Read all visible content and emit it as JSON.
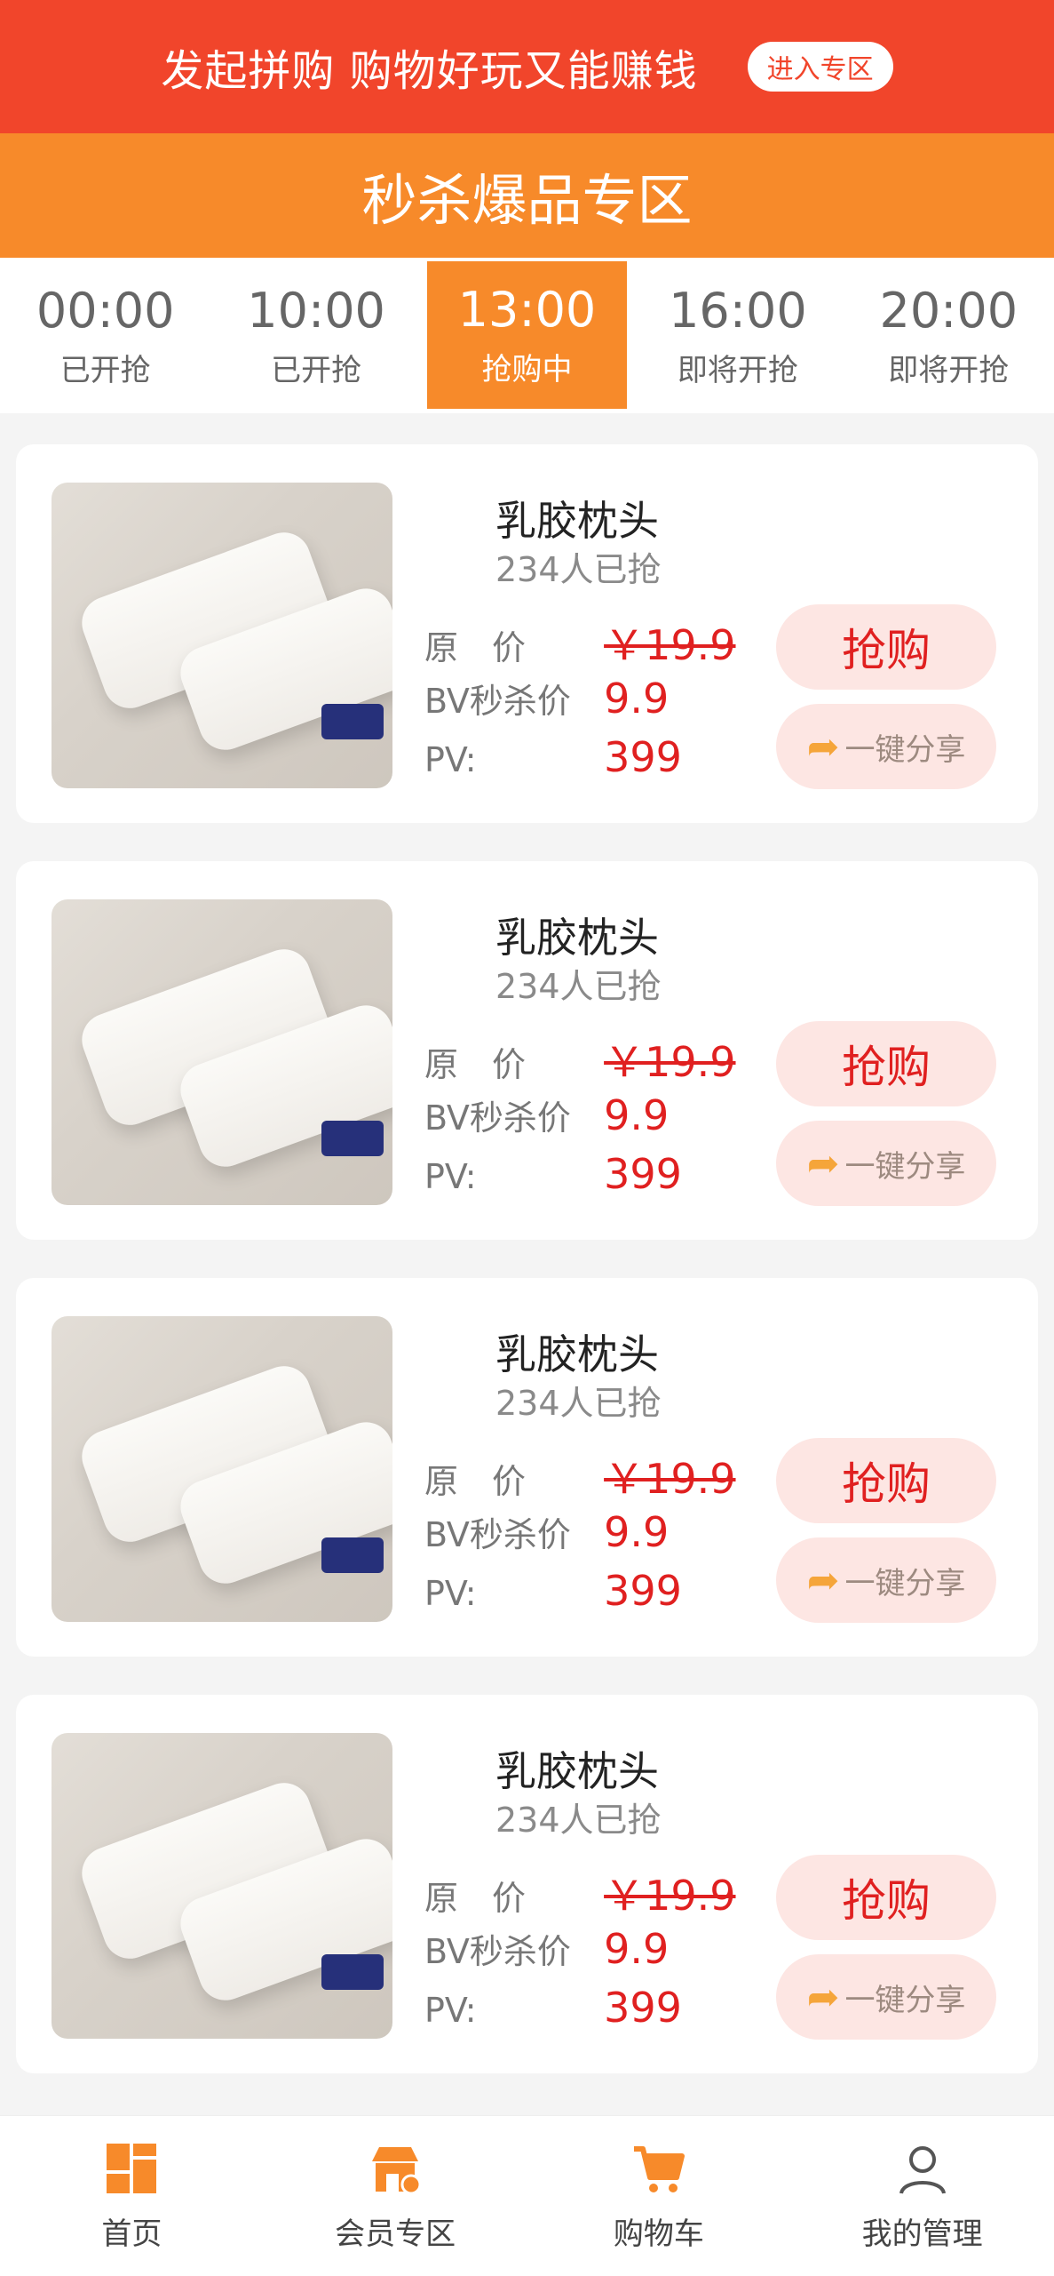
{
  "banner": {
    "text": "发起拼购 购物好玩又能赚钱",
    "button": "进入专区"
  },
  "section": {
    "title": "秒杀爆品专区"
  },
  "tabs": [
    {
      "time": "00:00",
      "status": "已开抢"
    },
    {
      "time": "10:00",
      "status": "已开抢"
    },
    {
      "time": "13:00",
      "status": "抢购中"
    },
    {
      "time": "16:00",
      "status": "即将开抢"
    },
    {
      "time": "20:00",
      "status": "即将开抢"
    }
  ],
  "products": [
    {
      "title": "乳胶枕头",
      "sold": "234人已抢",
      "orig_label": "原　价",
      "orig_price": "￥19.9",
      "bv_label": "BV秒杀价",
      "bv_price": "9.9",
      "pv_label": "PV:",
      "pv_value": "399",
      "buy": "抢购",
      "share": "一键分享"
    },
    {
      "title": "乳胶枕头",
      "sold": "234人已抢",
      "orig_label": "原　价",
      "orig_price": "￥19.9",
      "bv_label": "BV秒杀价",
      "bv_price": "9.9",
      "pv_label": "PV:",
      "pv_value": "399",
      "buy": "抢购",
      "share": "一键分享"
    },
    {
      "title": "乳胶枕头",
      "sold": "234人已抢",
      "orig_label": "原　价",
      "orig_price": "￥19.9",
      "bv_label": "BV秒杀价",
      "bv_price": "9.9",
      "pv_label": "PV:",
      "pv_value": "399",
      "buy": "抢购",
      "share": "一键分享"
    },
    {
      "title": "乳胶枕头",
      "sold": "234人已抢",
      "orig_label": "原　价",
      "orig_price": "￥19.9",
      "bv_label": "BV秒杀价",
      "bv_price": "9.9",
      "pv_label": "PV:",
      "pv_value": "399",
      "buy": "抢购",
      "share": "一键分享"
    }
  ],
  "nav": [
    {
      "label": "首页",
      "icon": "home-icon"
    },
    {
      "label": "会员专区",
      "icon": "member-store-icon"
    },
    {
      "label": "购物车",
      "icon": "cart-icon"
    },
    {
      "label": "我的管理",
      "icon": "user-icon"
    }
  ],
  "colors": {
    "banner": "#f1452b",
    "accent": "#f78a2a",
    "price": "#e02020"
  }
}
